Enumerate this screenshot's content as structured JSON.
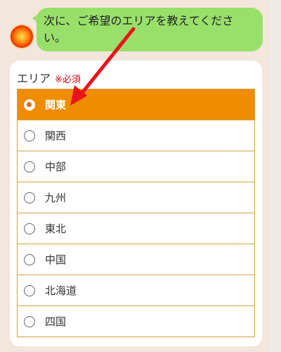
{
  "chat": {
    "message": "次に、ご希望のエリアを教えてください。"
  },
  "form": {
    "label": "エリア",
    "required_mark": "※必須",
    "options": [
      {
        "label": "関東",
        "selected": true
      },
      {
        "label": "関西",
        "selected": false
      },
      {
        "label": "中部",
        "selected": false
      },
      {
        "label": "九州",
        "selected": false
      },
      {
        "label": "東北",
        "selected": false
      },
      {
        "label": "中国",
        "selected": false
      },
      {
        "label": "北海道",
        "selected": false
      },
      {
        "label": "四国",
        "selected": false
      }
    ]
  },
  "colors": {
    "bubble": "#98e06a",
    "selected": "#f08c00",
    "border": "#d4a13c",
    "required": "#e0001b",
    "arrow": "#e8141c"
  }
}
